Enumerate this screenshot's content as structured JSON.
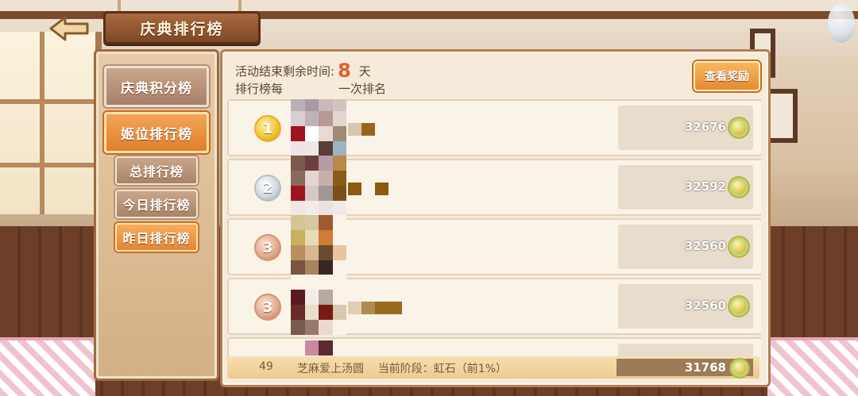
{
  "header": {
    "title": "庆典排行榜"
  },
  "sidebar": {
    "main_items": [
      {
        "label": "庆典积分榜",
        "active": false
      },
      {
        "label": "姬位排行榜",
        "active": true
      }
    ],
    "sub_items": [
      {
        "label": "总排行榜",
        "active": false
      },
      {
        "label": "今日排行榜",
        "active": false
      },
      {
        "label": "昨日排行榜",
        "active": true
      }
    ]
  },
  "info": {
    "remaining_label": "活动结束剩余时间:",
    "remaining_value": "8",
    "remaining_unit": "天",
    "refresh_prefix": "排行榜每",
    "refresh_suffix": "一次排名"
  },
  "reward_button": "查看奖励",
  "rows": [
    {
      "rank": "1",
      "medal": "gold",
      "score": "32676"
    },
    {
      "rank": "2",
      "medal": "silver",
      "score": "32592"
    },
    {
      "rank": "3",
      "medal": "bronze",
      "score": "32560"
    },
    {
      "rank": "3",
      "medal": "bronze",
      "score": "32560"
    }
  ],
  "self": {
    "rank": "49",
    "name": "芝麻爱上汤圆",
    "stage": "当前阶段：虹石（前1%）",
    "score": "31768"
  },
  "colors": {
    "accent": "#e58533",
    "countdown": "#e0602b",
    "panel": "#f6ebda"
  },
  "icons": [
    "back-arrow-icon",
    "coin-icon",
    "medal-icon"
  ]
}
